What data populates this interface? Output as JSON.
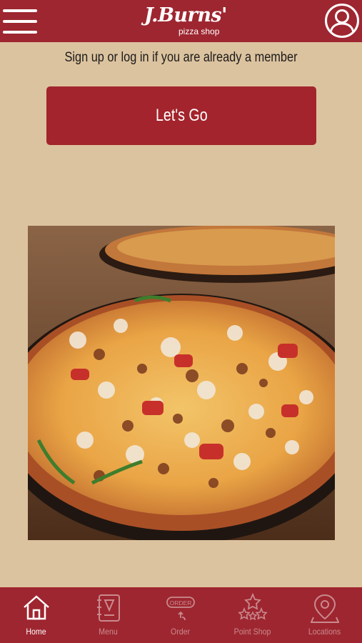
{
  "header": {
    "logo_main": "J.Burns'",
    "logo_sub": "pizza shop"
  },
  "main": {
    "prompt": "Sign up or log in if you are already a member",
    "cta_label": "Let's Go"
  },
  "bottom_nav": {
    "items": [
      {
        "label": "Home",
        "icon": "home-icon",
        "active": true
      },
      {
        "label": "Menu",
        "icon": "menu-book-icon",
        "active": false
      },
      {
        "label": "Order",
        "icon": "order-icon",
        "active": false,
        "icon_text": "ORDER"
      },
      {
        "label": "Point Shop",
        "icon": "stars-icon",
        "active": false
      },
      {
        "label": "Locations",
        "icon": "location-pin-icon",
        "active": false
      }
    ]
  },
  "colors": {
    "brand_red": "#9e2630",
    "background": "#dcc39f",
    "inactive_nav": "#c98a8e"
  }
}
